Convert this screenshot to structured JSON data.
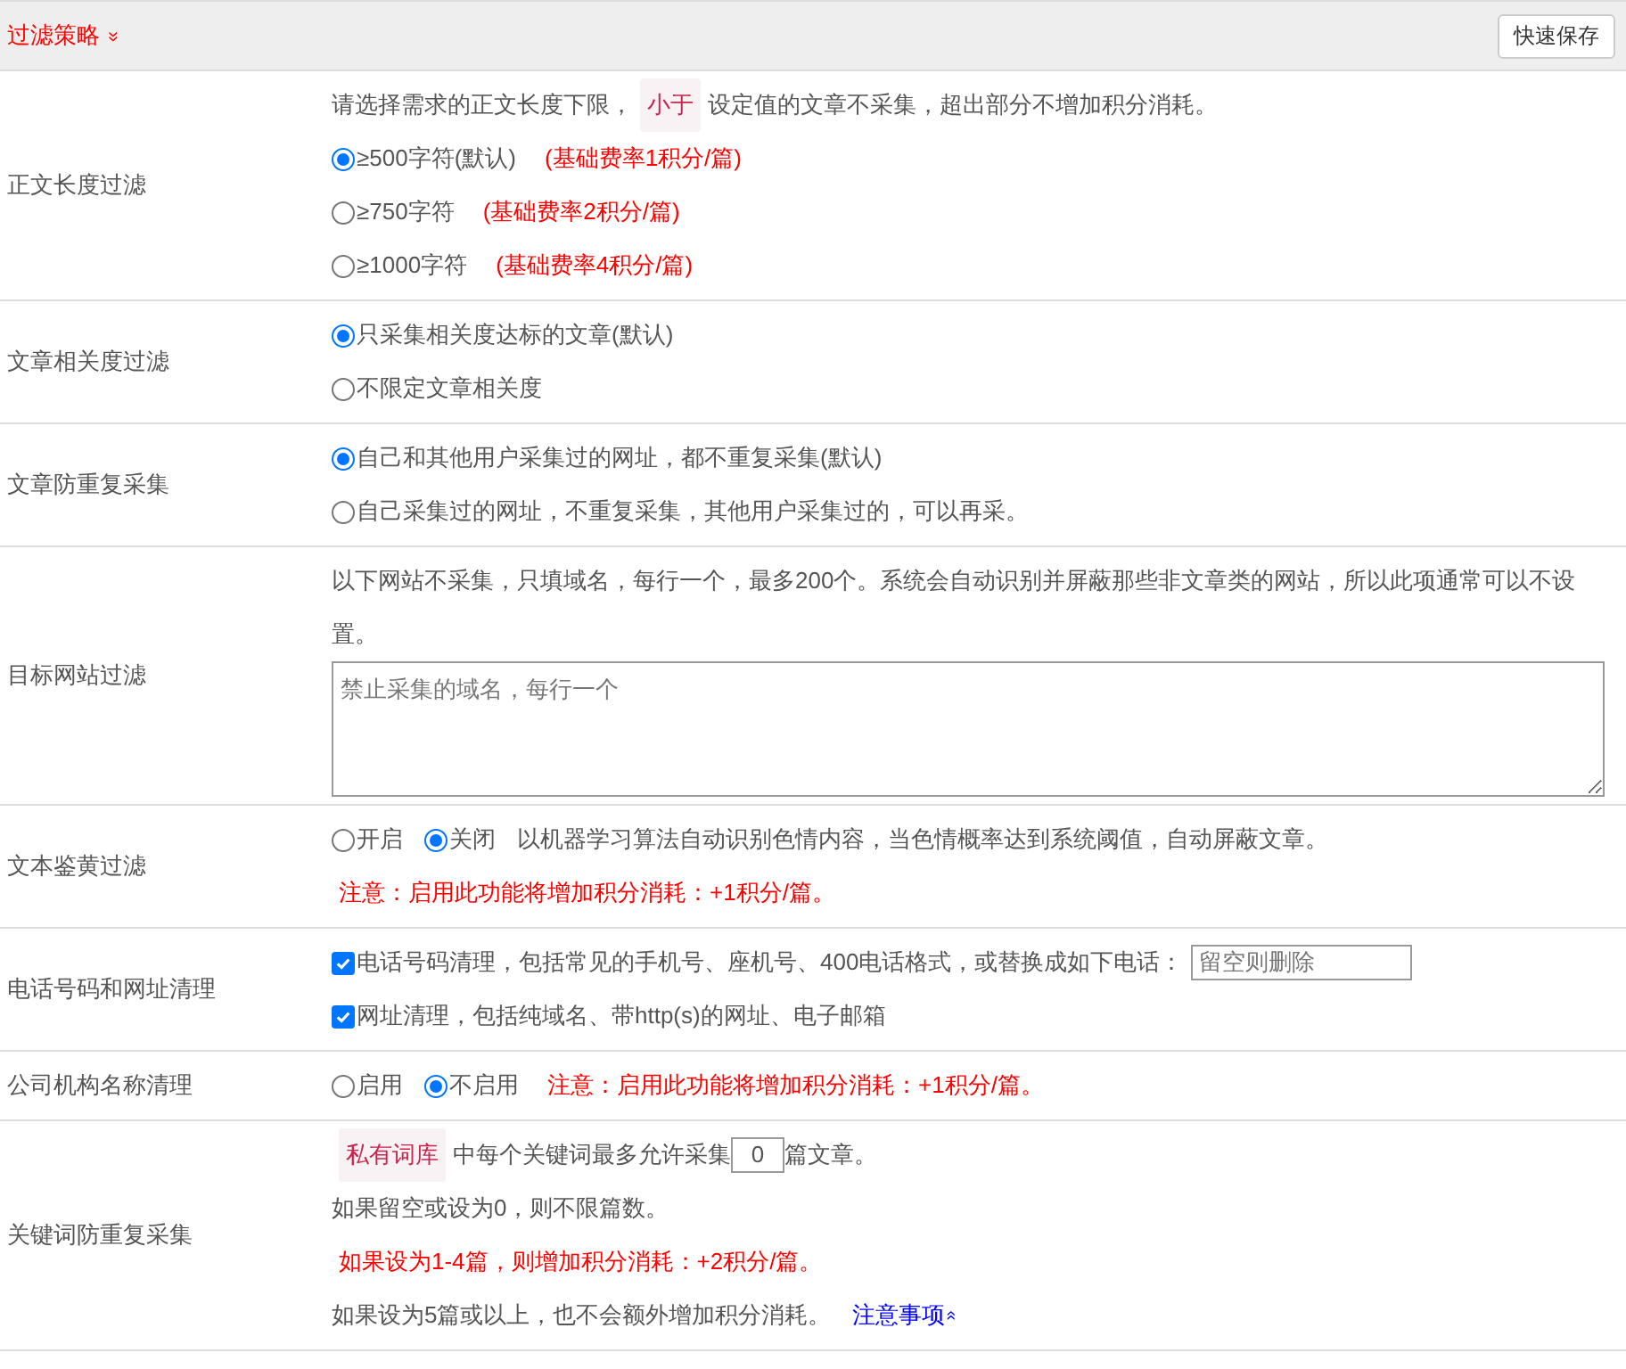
{
  "header": {
    "title": "过滤策略",
    "toggle": "»",
    "save_button": "快速保存"
  },
  "rows": [
    {
      "label": "正文长度过滤",
      "lines": [
        {
          "segments": [
            {
              "kind": "text",
              "text": "请选择需求的正文长度下限，"
            },
            {
              "kind": "tag",
              "text": "小于"
            },
            {
              "kind": "text",
              "text": "设定值的文章不采集，超出部分不增加积分消耗。"
            }
          ]
        },
        {
          "segments": [
            {
              "kind": "radio",
              "text": "≥500字符(默认)",
              "selected": true
            },
            {
              "kind": "note",
              "text": "(基础费率1积分/篇)"
            }
          ]
        },
        {
          "segments": [
            {
              "kind": "radio",
              "text": "≥750字符",
              "selected": false
            },
            {
              "kind": "note",
              "text": "(基础费率2积分/篇)"
            }
          ]
        },
        {
          "segments": [
            {
              "kind": "radio",
              "text": "≥1000字符",
              "selected": false
            },
            {
              "kind": "note",
              "text": "(基础费率4积分/篇)"
            }
          ]
        }
      ]
    },
    {
      "label": "文章相关度过滤",
      "lines": [
        {
          "segments": [
            {
              "kind": "radio",
              "text": "只采集相关度达标的文章(默认)",
              "selected": true
            }
          ]
        },
        {
          "segments": [
            {
              "kind": "radio",
              "text": "不限定文章相关度",
              "selected": false
            }
          ]
        }
      ]
    },
    {
      "label": "文章防重复采集",
      "lines": [
        {
          "segments": [
            {
              "kind": "radio",
              "text": "自己和其他用户采集过的网址，都不重复采集(默认)",
              "selected": true
            }
          ]
        },
        {
          "segments": [
            {
              "kind": "radio",
              "text": "自己采集过的网址，不重复采集，其他用户采集过的，可以再采。",
              "selected": false
            }
          ]
        }
      ]
    },
    {
      "label": "目标网站过滤",
      "lines": [
        {
          "segments": [
            {
              "kind": "text",
              "text": "以下网站不采集，只填域名，每行一个，最多200个。系统会自动识别并屏蔽那些非文章类的网站，所以此项通常可以不设置。"
            }
          ]
        },
        {
          "segments": [
            {
              "kind": "textarea",
              "placeholder": "禁止采集的域名，每行一个"
            }
          ]
        }
      ]
    },
    {
      "label": "文本鉴黄过滤",
      "lines": [
        {
          "segments": [
            {
              "kind": "radio",
              "text": "开启",
              "selected": false
            },
            {
              "kind": "radio",
              "text": "关闭",
              "selected": true
            },
            {
              "kind": "text",
              "text": "以机器学习算法自动识别色情内容，当色情概率达到系统阈值，自动屏蔽文章。"
            }
          ]
        },
        {
          "segments": [
            {
              "kind": "note",
              "text": "注意：启用此功能将增加积分消耗：+1积分/篇。"
            }
          ]
        }
      ]
    },
    {
      "label": "电话号码和网址清理",
      "lines": [
        {
          "segments": [
            {
              "kind": "checkbox",
              "text": "电话号码清理，包括常见的手机号、座机号、400电话格式，或替换成如下电话：",
              "checked": true
            },
            {
              "kind": "input",
              "placeholder": "留空则删除"
            }
          ]
        },
        {
          "segments": [
            {
              "kind": "checkbox",
              "text": "网址清理，包括纯域名、带http(s)的网址、电子邮箱",
              "checked": true
            }
          ]
        }
      ]
    },
    {
      "label": "公司机构名称清理",
      "lines": [
        {
          "segments": [
            {
              "kind": "radio",
              "text": "启用",
              "selected": false
            },
            {
              "kind": "radio",
              "text": "不启用",
              "selected": true
            },
            {
              "kind": "note",
              "text": "注意：启用此功能将增加积分消耗：+1积分/篇。"
            }
          ]
        }
      ]
    },
    {
      "label": "关键词防重复采集",
      "lines": [
        {
          "segments": [
            {
              "kind": "tag",
              "text": "私有词库"
            },
            {
              "kind": "text",
              "text": "中每个关键词最多允许采集"
            },
            {
              "kind": "number",
              "value": "0"
            },
            {
              "kind": "text",
              "text": "篇文章。"
            }
          ]
        },
        {
          "segments": [
            {
              "kind": "text",
              "text": "如果留空或设为0，则不限篇数。"
            }
          ]
        },
        {
          "segments": [
            {
              "kind": "note",
              "text": "如果设为1-4篇，则增加积分消耗：+2积分/篇。"
            }
          ]
        },
        {
          "segments": [
            {
              "kind": "text",
              "text": "如果设为5篇或以上，也不会额外增加积分消耗。"
            },
            {
              "kind": "link",
              "text": "注意事项",
              "toggle": "»"
            }
          ]
        }
      ]
    }
  ]
}
